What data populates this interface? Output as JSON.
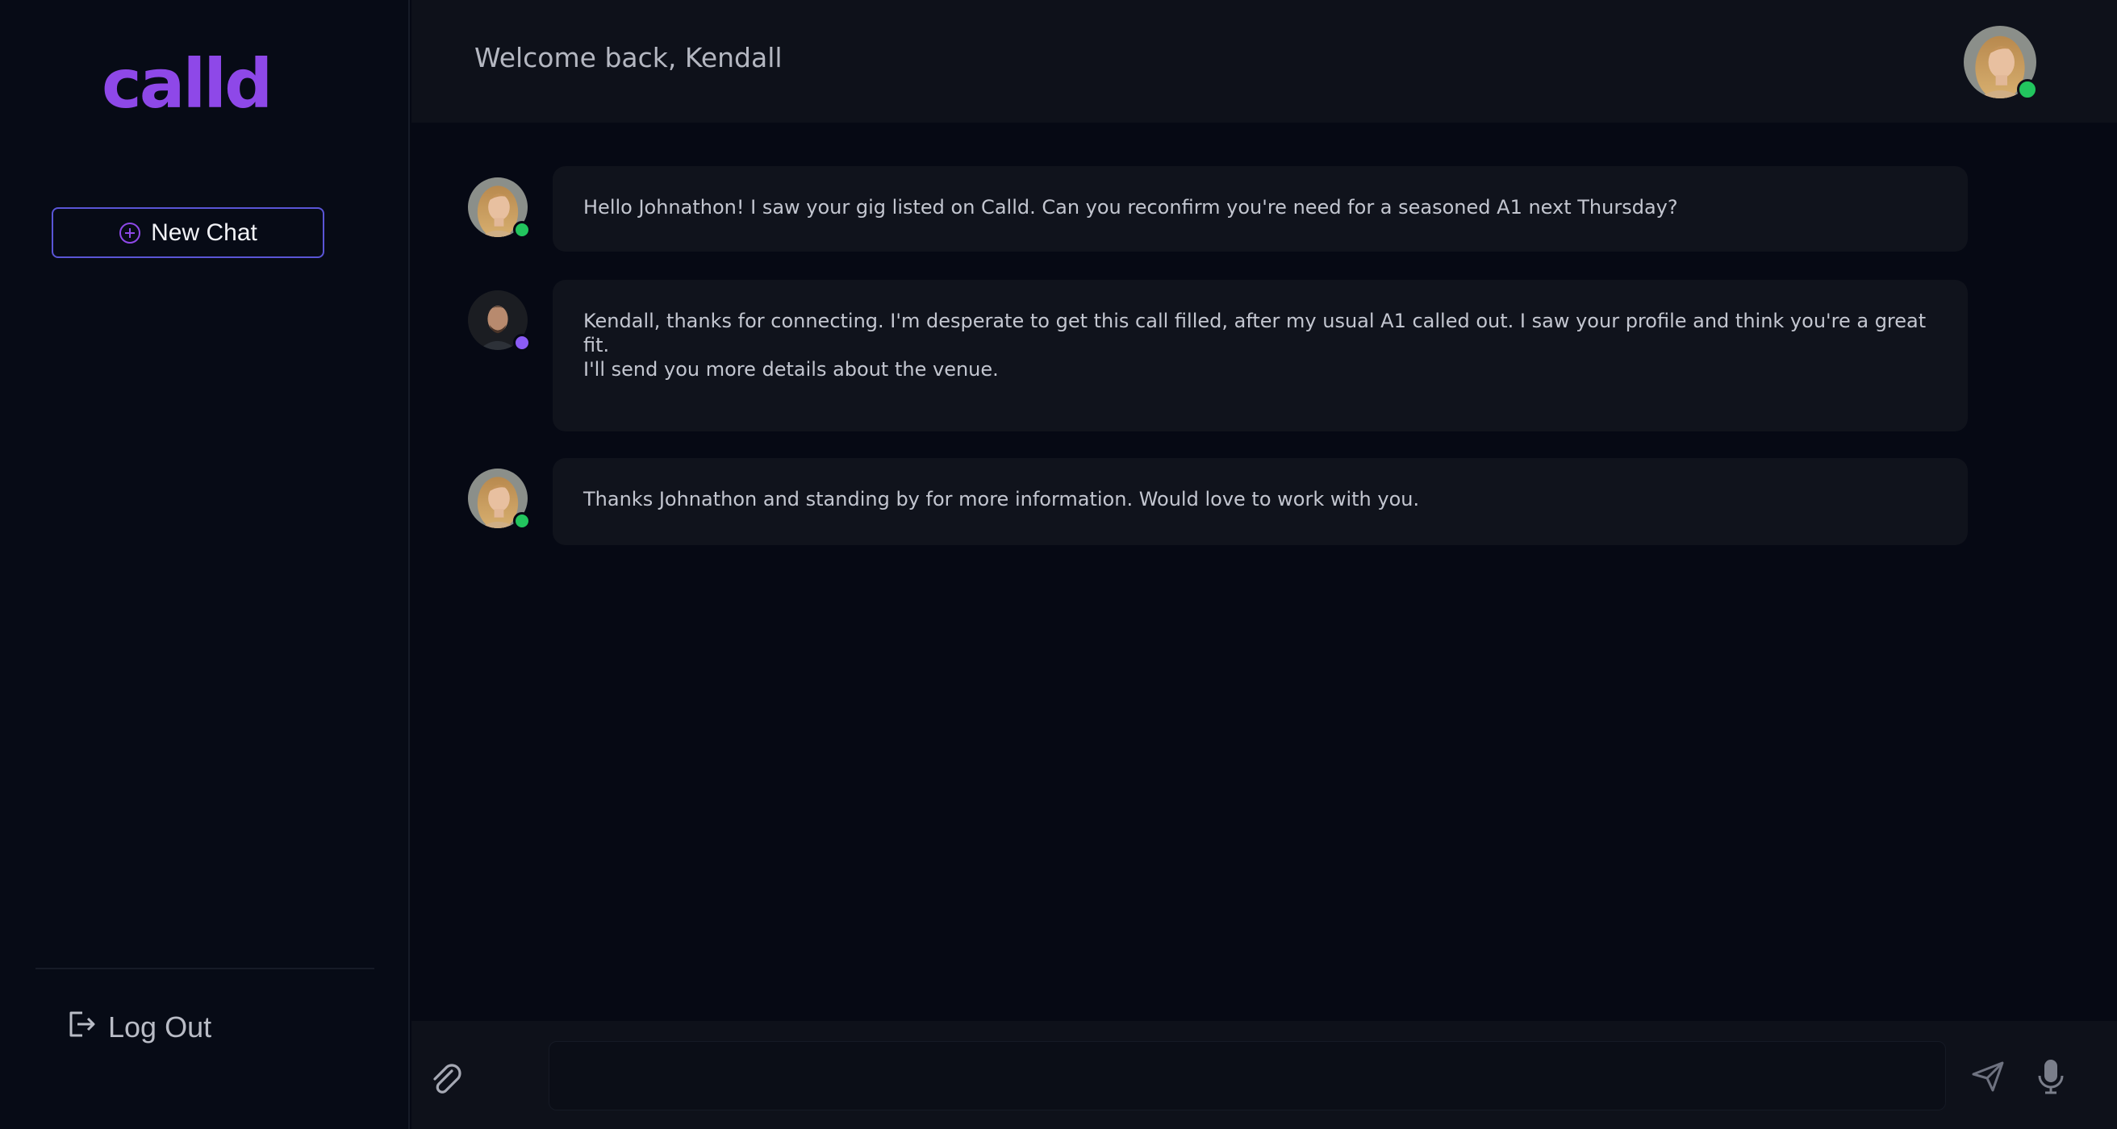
{
  "brand": {
    "logo_text": "calld",
    "accent_color": "#8e48e8"
  },
  "sidebar": {
    "new_chat_label": "New Chat",
    "new_chat_icon": "plus-circle-icon",
    "logout_label": "Log Out",
    "logout_icon": "logout-icon"
  },
  "header": {
    "welcome_text": "Welcome back, Kendall",
    "avatar": {
      "user": "Kendall",
      "status": "online",
      "status_color": "#22c55e"
    }
  },
  "messages": [
    {
      "sender": "Kendall",
      "status_color": "#22c55e",
      "text": "Hello Johnathon!  I saw your gig listed on Calld.  Can you reconfirm you're need for a seasoned A1 next Thursday?"
    },
    {
      "sender": "Johnathon",
      "status_color": "#8b5cf6",
      "text": "Kendall, thanks for connecting.  I'm desperate to get this call filled, after my usual A1 called out.  I saw your profile and think you're a great fit.\nI'll send you more details about the venue."
    },
    {
      "sender": "Kendall",
      "status_color": "#22c55e",
      "text": "Thanks Johnathon and standing by for more information.  Would love to work with you."
    }
  ],
  "composer": {
    "input_value": "",
    "placeholder": "",
    "attach_icon": "paperclip-icon",
    "send_icon": "send-icon",
    "mic_icon": "microphone-icon"
  }
}
